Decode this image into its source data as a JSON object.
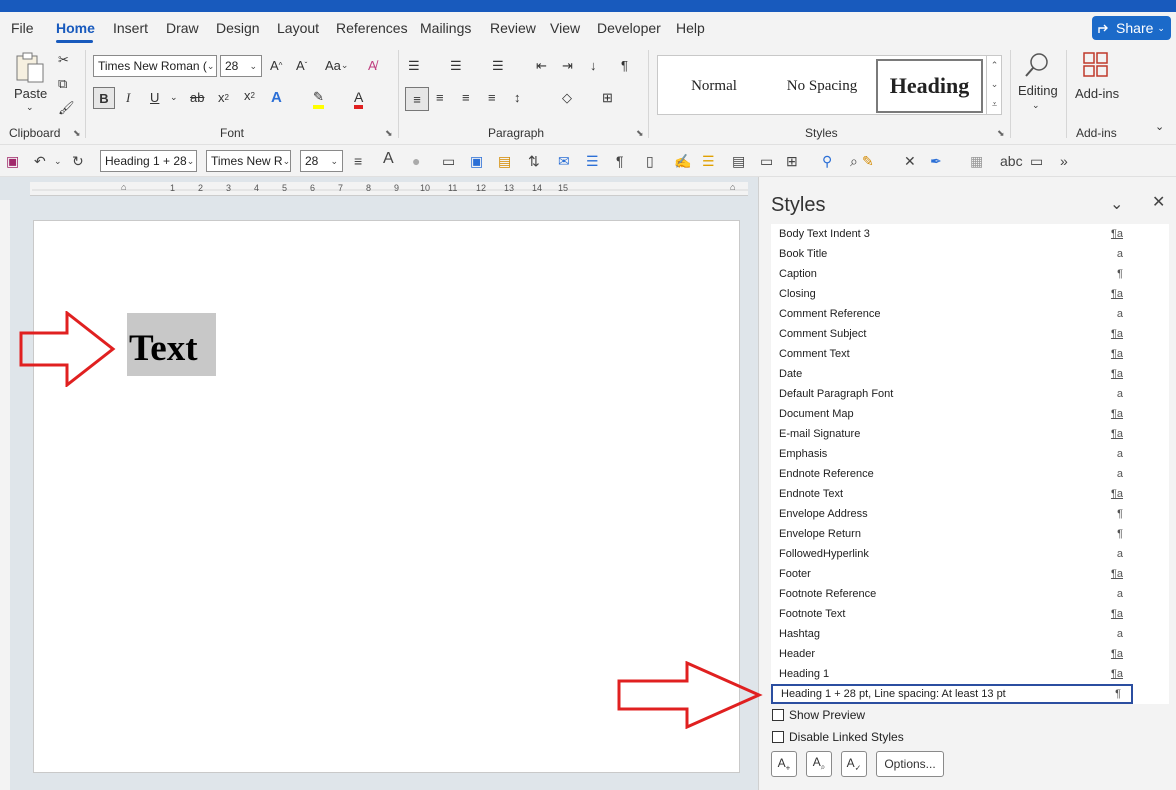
{
  "menu": {
    "tabs": [
      "File",
      "Home",
      "Insert",
      "Draw",
      "Design",
      "Layout",
      "References",
      "Mailings",
      "Review",
      "View",
      "Developer",
      "Help"
    ],
    "active": "Home",
    "share_label": "Share"
  },
  "ribbon": {
    "clipboard": {
      "paste_label": "Paste",
      "group_label": "Clipboard"
    },
    "font": {
      "font_name": "Times New Roman (",
      "font_size": "28",
      "change_case": "Aa",
      "group_label": "Font"
    },
    "paragraph": {
      "group_label": "Paragraph"
    },
    "styles": {
      "items": [
        "Normal",
        "No Spacing",
        "Heading"
      ],
      "selected": "Heading",
      "group_label": "Styles"
    },
    "editing_label": "Editing",
    "addins_label": "Add-ins",
    "addins_group_label": "Add-ins"
  },
  "qat": {
    "style_combo": "Heading 1 + 28",
    "font_combo": "Times New R",
    "size_combo": "28"
  },
  "ruler": {
    "ticks": [
      "1",
      "2",
      "3",
      "4",
      "5",
      "6",
      "7",
      "8",
      "9",
      "10",
      "11",
      "12",
      "13",
      "14",
      "15"
    ]
  },
  "document": {
    "text": "Text"
  },
  "styles_pane": {
    "title": "Styles",
    "items": [
      {
        "name": "Body Text Indent 3",
        "symbol": "¶a",
        "linked": true
      },
      {
        "name": "Book Title",
        "symbol": "a",
        "linked": false
      },
      {
        "name": "Caption",
        "symbol": "¶",
        "linked": false
      },
      {
        "name": "Closing",
        "symbol": "¶a",
        "linked": true
      },
      {
        "name": "Comment Reference",
        "symbol": "a",
        "linked": false
      },
      {
        "name": "Comment Subject",
        "symbol": "¶a",
        "linked": true
      },
      {
        "name": "Comment Text",
        "symbol": "¶a",
        "linked": true
      },
      {
        "name": "Date",
        "symbol": "¶a",
        "linked": true
      },
      {
        "name": "Default Paragraph Font",
        "symbol": "a",
        "linked": false
      },
      {
        "name": "Document Map",
        "symbol": "¶a",
        "linked": true
      },
      {
        "name": "E-mail Signature",
        "symbol": "¶a",
        "linked": true
      },
      {
        "name": "Emphasis",
        "symbol": "a",
        "linked": false
      },
      {
        "name": "Endnote Reference",
        "symbol": "a",
        "linked": false
      },
      {
        "name": "Endnote Text",
        "symbol": "¶a",
        "linked": true
      },
      {
        "name": "Envelope Address",
        "symbol": "¶",
        "linked": false
      },
      {
        "name": "Envelope Return",
        "symbol": "¶",
        "linked": false
      },
      {
        "name": "FollowedHyperlink",
        "symbol": "a",
        "linked": false
      },
      {
        "name": "Footer",
        "symbol": "¶a",
        "linked": true
      },
      {
        "name": "Footnote Reference",
        "symbol": "a",
        "linked": false
      },
      {
        "name": "Footnote Text",
        "symbol": "¶a",
        "linked": true
      },
      {
        "name": "Hashtag",
        "symbol": "a",
        "linked": false
      },
      {
        "name": "Header",
        "symbol": "¶a",
        "linked": true
      },
      {
        "name": "Heading 1",
        "symbol": "¶a",
        "linked": true
      },
      {
        "name": "Heading 1 + 28 pt, Line spacing:  At least 13 pt",
        "symbol": "¶",
        "linked": false,
        "selected": true
      }
    ],
    "show_preview": "Show Preview",
    "disable_linked": "Disable Linked Styles",
    "options_label": "Options..."
  },
  "colors": {
    "accent": "#185abd",
    "arrow": "#e02020",
    "selection_border": "#2b4ea0"
  }
}
